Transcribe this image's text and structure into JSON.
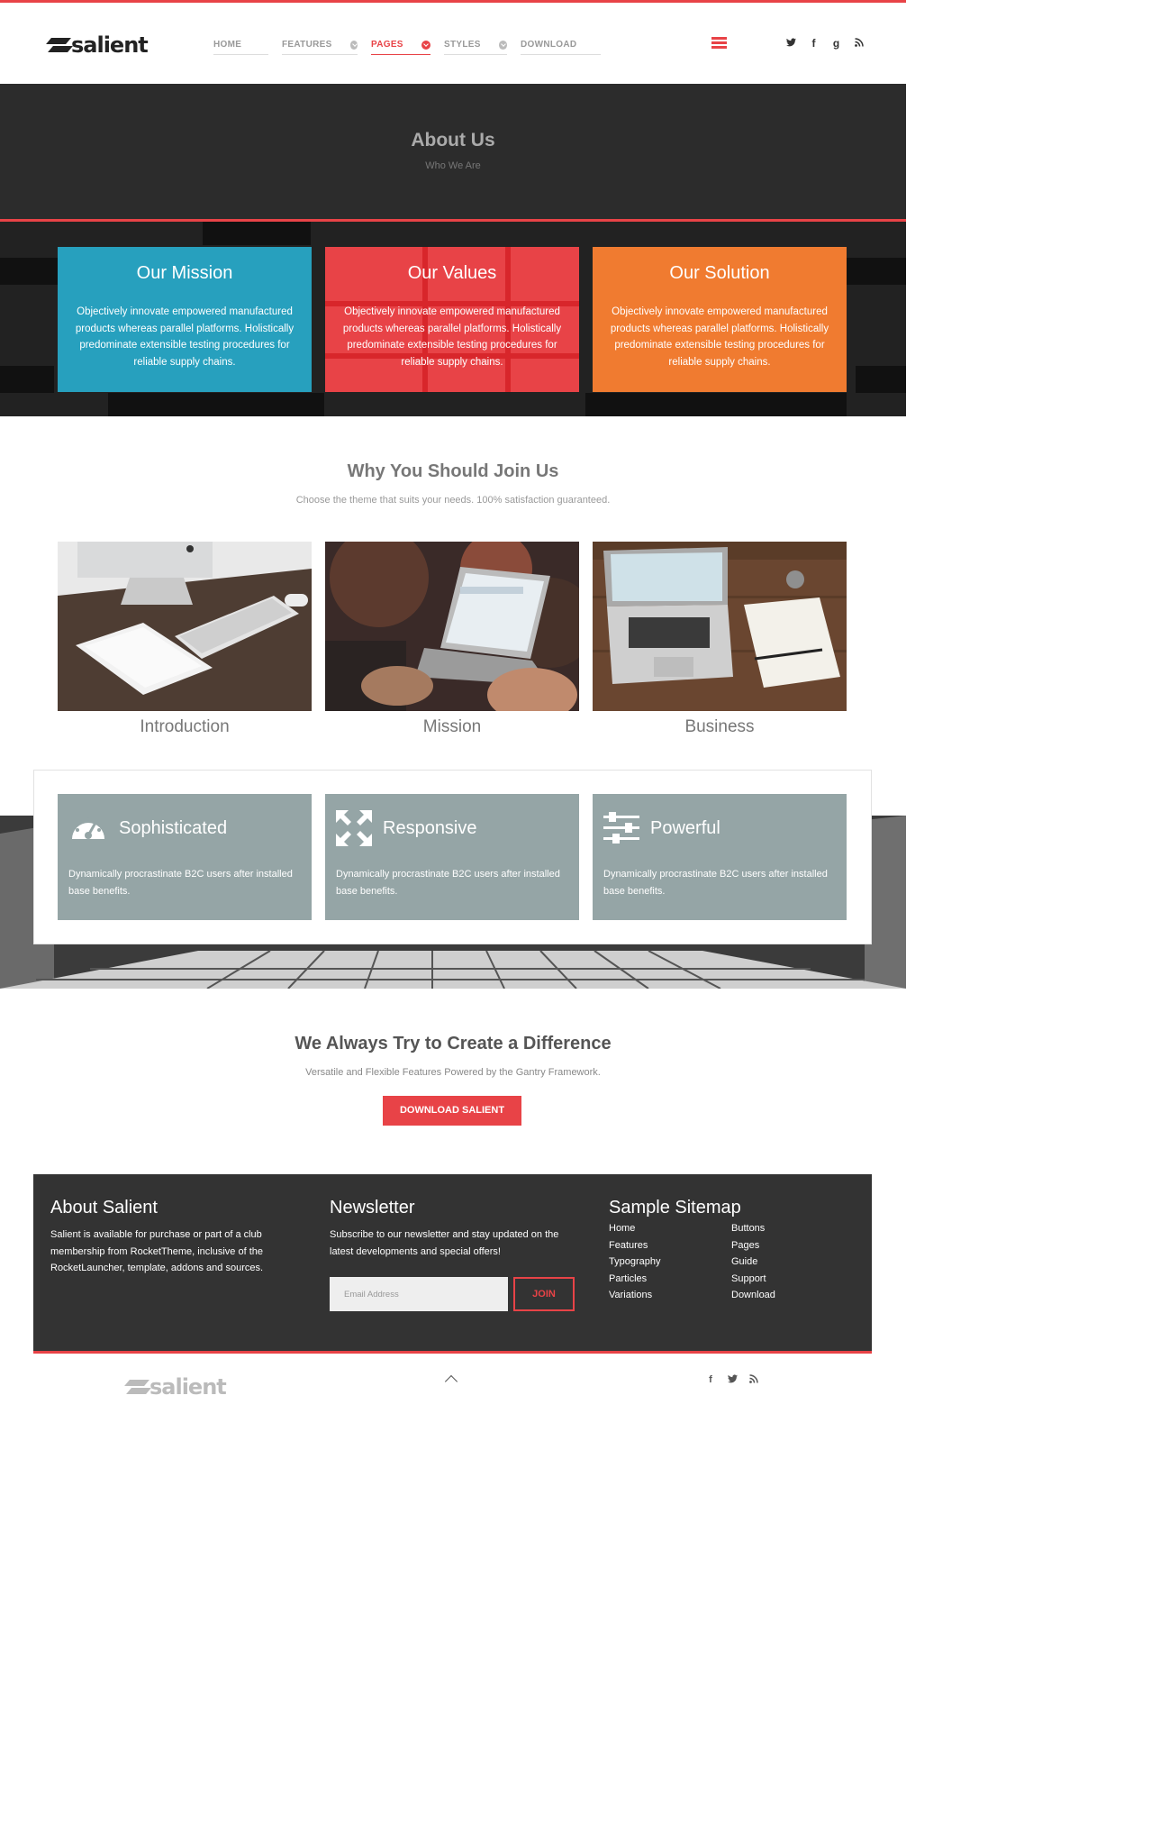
{
  "brand": {
    "name": "salient"
  },
  "nav": {
    "items": [
      {
        "label": "HOME",
        "has_dropdown": false,
        "active": false
      },
      {
        "label": "FEATURES",
        "has_dropdown": true,
        "active": false
      },
      {
        "label": "PAGES",
        "has_dropdown": true,
        "active": true
      },
      {
        "label": "STYLES",
        "has_dropdown": true,
        "active": false
      },
      {
        "label": "DOWNLOAD",
        "has_dropdown": false,
        "active": false
      }
    ],
    "menu_icon": "offcanvas-menu-icon",
    "social": {
      "twitter": "t",
      "facebook": "f",
      "google": "g",
      "rss": "rss-icon"
    }
  },
  "hero": {
    "title": "About Us",
    "subtitle": "Who We Are"
  },
  "tiles": [
    {
      "title": "Our Mission",
      "text": "Objectively innovate empowered manufactured products whereas parallel platforms. Holistically predominate extensible testing procedures for reliable supply chains.",
      "color": "#27a0be"
    },
    {
      "title": "Our Values",
      "text": "Objectively innovate empowered manufactured products whereas parallel platforms. Holistically predominate extensible testing procedures for reliable supply chains.",
      "color": "#e84347"
    },
    {
      "title": "Our Solution",
      "text": "Objectively innovate empowered manufactured products whereas parallel platforms. Holistically predominate extensible testing procedures for reliable supply chains.",
      "color": "#f07b30"
    }
  ],
  "why": {
    "title": "Why You Should Join Us",
    "subtitle": "Choose the theme that suits your needs. 100% satisfaction guaranteed.",
    "cards": [
      {
        "caption": "Introduction"
      },
      {
        "caption": "Mission"
      },
      {
        "caption": "Business"
      }
    ]
  },
  "features": [
    {
      "title": "Sophisticated",
      "text": "Dynamically procrastinate B2C users after installed base benefits.",
      "icon": "dashboard-icon"
    },
    {
      "title": "Responsive",
      "text": "Dynamically procrastinate B2C users after installed base benefits.",
      "icon": "expand-arrows-icon"
    },
    {
      "title": "Powerful",
      "text": "Dynamically procrastinate B2C users after installed base benefits.",
      "icon": "sliders-icon"
    }
  ],
  "cta": {
    "title": "We Always Try to Create a Difference",
    "subtitle": "Versatile and Flexible Features Powered by the Gantry Framework.",
    "button": "DOWNLOAD SALIENT"
  },
  "footer": {
    "about": {
      "title": "About Salient",
      "text": "Salient is available for purchase or part of a club membership from RocketTheme, inclusive of the RocketLauncher, template, addons and sources."
    },
    "newsletter": {
      "title": "Newsletter",
      "text": "Subscribe to our newsletter and stay updated on the latest developments and special offers!",
      "placeholder": "Email Address",
      "button": "JOIN"
    },
    "sitemap": {
      "title": "Sample Sitemap",
      "col1": [
        "Home",
        "Features",
        "Typography",
        "Particles",
        "Variations"
      ],
      "col2": [
        "Buttons",
        "Pages",
        "Guide",
        "Support",
        "Download"
      ]
    },
    "accent": "#e84347"
  }
}
